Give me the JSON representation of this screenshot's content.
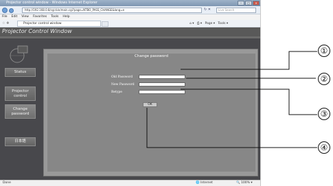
{
  "browser": {
    "title": "Projector control window - Windows Internet Explorer",
    "url": "http://192.168.0.8/cgi-bin/main.cgi?page=NTBO_PASS_CHANGE&lang=e",
    "search_placeholder": "Live Search",
    "menu": [
      "File",
      "Edit",
      "View",
      "Favorites",
      "Tools",
      "Help"
    ],
    "tab_label": "Projector control window",
    "toolbar_page": "Page",
    "toolbar_tools": "Tools",
    "status_left": "Done",
    "status_zone": "Internet",
    "status_zoom": "100%"
  },
  "app": {
    "title": "Projector Control Window",
    "sidebar": {
      "status": "Status",
      "projector_control": "Projector control",
      "change_password": "Change password",
      "language": "日本語"
    }
  },
  "form": {
    "title": "Change password",
    "old_password_label": "Old Password",
    "new_password_label": "New Password",
    "retype_label": "Retype",
    "old_password_value": "",
    "new_password_value": "",
    "retype_value": "",
    "ok_label": "OK"
  },
  "callouts": [
    "①",
    "②",
    "③",
    "④"
  ]
}
